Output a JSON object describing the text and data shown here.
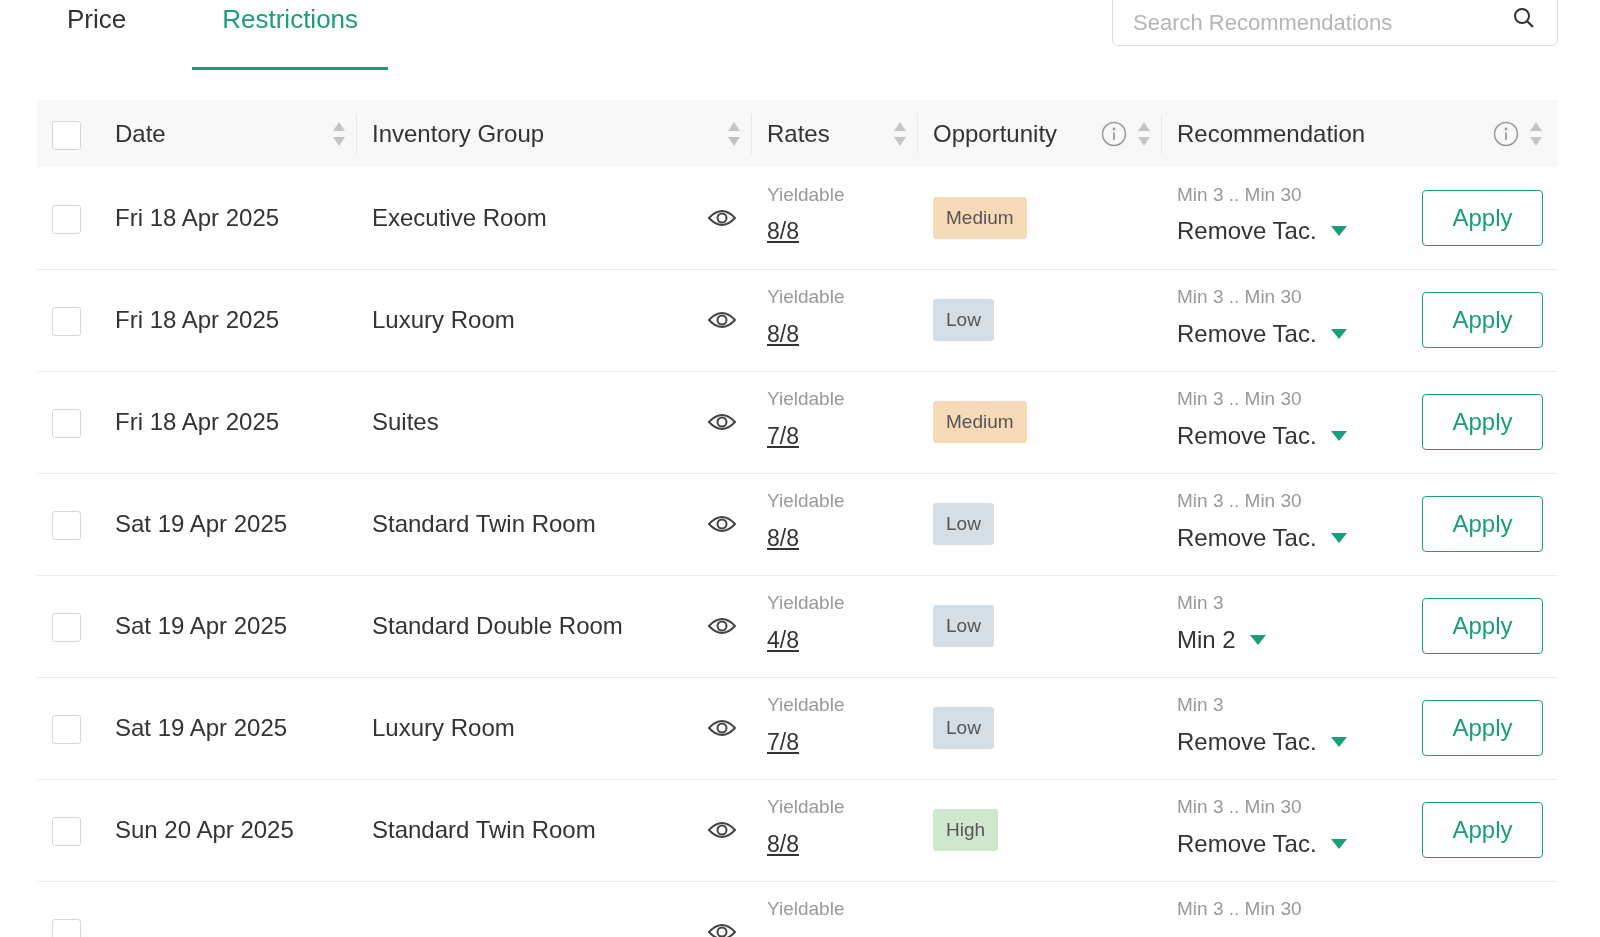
{
  "tabs": [
    {
      "label": "Price",
      "selected": false
    },
    {
      "label": "Restrictions",
      "selected": true
    }
  ],
  "search": {
    "placeholder": "Search Recommendations"
  },
  "table": {
    "select_all": {
      "checked": false
    },
    "columns": [
      {
        "label": "Date",
        "sortable": true,
        "info": false
      },
      {
        "label": "Inventory Group",
        "sortable": true,
        "info": false
      },
      {
        "label": "Rates",
        "sortable": true,
        "info": false
      },
      {
        "label": "Opportunity",
        "sortable": true,
        "info": true
      },
      {
        "label": "Recommendation",
        "sortable": true,
        "info": true
      }
    ],
    "rows": [
      {
        "checked": false,
        "date": "Fri 18 Apr 2025",
        "inventory_group": "Executive Room",
        "rates_label": "Yieldable",
        "rates_value": "8/8",
        "opportunity": "Medium",
        "color": "#f6d9b7",
        "current": "Min 3 .. Min 30",
        "recommended": "Remove Tac.",
        "action": "Apply"
      },
      {
        "checked": false,
        "date": "Fri 18 Apr 2025",
        "inventory_group": "Luxury Room",
        "rates_label": "Yieldable",
        "rates_value": "8/8",
        "opportunity": "Low",
        "color": "#d5dee5",
        "current": "Min 3 .. Min 30",
        "recommended": "Remove Tac.",
        "action": "Apply"
      },
      {
        "checked": false,
        "date": "Fri 18 Apr 2025",
        "inventory_group": "Suites",
        "rates_label": "Yieldable",
        "rates_value": "7/8",
        "opportunity": "Medium",
        "color": "#f6d9b7",
        "current": "Min 3 .. Min 30",
        "recommended": "Remove Tac.",
        "action": "Apply"
      },
      {
        "checked": false,
        "date": "Sat 19 Apr 2025",
        "inventory_group": "Standard Twin Room",
        "rates_label": "Yieldable",
        "rates_value": "8/8",
        "opportunity": "Low",
        "color": "#d5dee5",
        "current": "Min 3 .. Min 30",
        "recommended": "Remove Tac.",
        "action": "Apply"
      },
      {
        "checked": false,
        "date": "Sat 19 Apr 2025",
        "inventory_group": "Standard Double Room",
        "rates_label": "Yieldable",
        "rates_value": "4/8",
        "opportunity": "Low",
        "color": "#d5dee5",
        "current": "Min 3",
        "recommended": "Min 2",
        "action": "Apply"
      },
      {
        "checked": false,
        "date": "Sat 19 Apr 2025",
        "inventory_group": "Luxury Room",
        "rates_label": "Yieldable",
        "rates_value": "7/8",
        "opportunity": "Low",
        "color": "#d5dee5",
        "current": "Min 3",
        "recommended": "Remove Tac.",
        "action": "Apply"
      },
      {
        "checked": false,
        "date": "Sun 20 Apr 2025",
        "inventory_group": "Standard Twin Room",
        "rates_label": "Yieldable",
        "rates_value": "8/8",
        "opportunity": "High",
        "color": "#cfe7cd",
        "current": "Min 3 .. Min 30",
        "recommended": "Remove Tac.",
        "action": "Apply"
      },
      {
        "checked": false,
        "rates_label": "Yieldable",
        "current": "Min 3 .. Min 30"
      }
    ]
  }
}
